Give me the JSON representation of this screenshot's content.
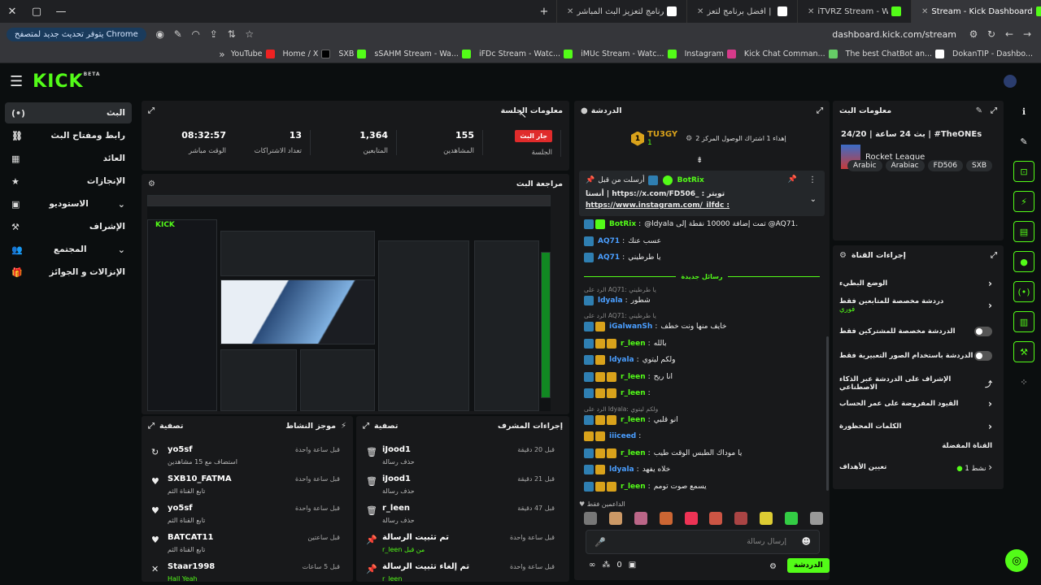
{
  "browser": {
    "tabs": [
      {
        "label": "Stream - Kick Dashboard",
        "active": true
      },
      {
        "label": "iTVRZ Stream - Watch Live on K"
      },
      {
        "label": "بوت الدردشة | أفضل برنامج لتعز"
      },
      {
        "label": "برنامج لتعزيز البث المباشر iFDc"
      }
    ],
    "update_label": "يتوفر تحديث جديد لمتصفح Chrome",
    "url": "dashboard.kick.com/stream",
    "bookmarks": [
      "YouTube",
      "Home / X",
      "SXB",
      "sSAHM Stream - Wa...",
      "iFDc Stream - Watc...",
      "iMUc Stream - Watc...",
      "Instagram",
      "Kick Chat Comman...",
      "The best ChatBot an...",
      "DokanTIP - Dashbo..."
    ]
  },
  "kick": {
    "logo": "KICK",
    "beta": "BETA"
  },
  "sidebar": {
    "items": [
      {
        "label": "البث",
        "icon": "(•)"
      },
      {
        "label": "رابط ومفتاح البث",
        "icon": "⛓"
      },
      {
        "label": "العائد",
        "icon": "▦"
      },
      {
        "label": "الإنجازات",
        "icon": "★"
      },
      {
        "label": "الاستوديو",
        "icon": "▣"
      },
      {
        "label": "الإشراف",
        "icon": "⚒"
      },
      {
        "label": "المجتمع",
        "icon": "👥"
      },
      {
        "label": "الإنزالات و الجوائز",
        "icon": "🎁"
      }
    ]
  },
  "session": {
    "title": "معلومات الجلسة",
    "live_badge": "جار البث",
    "live_label": "الجلسة",
    "stats": [
      {
        "value": "155",
        "label": "المشاهدين"
      },
      {
        "value": "1,364",
        "label": "المتابعين"
      },
      {
        "value": "13",
        "label": "تعداد الاشتراكات"
      },
      {
        "value": "08:32:57",
        "label": "الوقت مباشر"
      }
    ]
  },
  "preview": {
    "title": "مراجعة البث"
  },
  "activity": {
    "title": "موجز النشاط",
    "filter": "تصفية",
    "rows": [
      {
        "name": "yo5sf",
        "sub": "استضاف مع 15 مشاهدين",
        "time": "قبل ساعة واحدة",
        "icon": "↻"
      },
      {
        "name": "SXB10_FATMA",
        "sub": "تابع القناة الثم",
        "time": "قبل ساعة واحدة",
        "icon": "♥"
      },
      {
        "name": "yo5sf",
        "sub": "تابع القناة الثم",
        "time": "قبل ساعة واحدة",
        "icon": "♥"
      },
      {
        "name": "BATCAT11",
        "sub": "تابع القناة الثم",
        "time": "قبل ساعتين",
        "icon": "♥"
      },
      {
        "name": "Staar1998",
        "sub": "Hall Yeah",
        "time": "قبل 5 ساعات",
        "icon": "✕"
      }
    ]
  },
  "modactions": {
    "title": "إجراءات المشرف",
    "filter": "تصفية",
    "rows": [
      {
        "name": "iJood1",
        "sub": "حذف رسالة",
        "time": "قبل 20 دقيقة",
        "icon": "🗑"
      },
      {
        "name": "iJood1",
        "sub": "حذف رسالة",
        "time": "قبل 21 دقيقة",
        "icon": "🗑"
      },
      {
        "name": "r_leen",
        "sub": "حذف رسالة",
        "time": "قبل 47 دقيقة",
        "icon": "🗑"
      },
      {
        "name": "تم تثبيت الرسالة",
        "sub": "r_leen من قبل",
        "time": "قبل ساعة واحدة",
        "icon": "📌"
      },
      {
        "name": "تم إلغاء تثبيت الرسالة",
        "sub": "r_leen",
        "time": "قبل ساعة واحدة",
        "icon": "📌"
      }
    ]
  },
  "chat": {
    "title": "الدردشة",
    "top_user": "TU3GY",
    "top_rank": "1",
    "top_count": "1",
    "goal_text": "إهداء 1 اشتراك الوصول المركز 2",
    "pinned_by": "أرسلت من قبل",
    "pinned_user": "BotRix",
    "pinned_line1": "أنستا | https://x.com/FD506_ : تويتر",
    "pinned_line2": "https://www.instagram.com/_ilfdc :",
    "new_messages": "رسائل جديدة",
    "messages": [
      {
        "user": "BotRix",
        "text": "@ldyala تمت إضافة 10000 نقطة إلى @AQ71.",
        "color": "#53fc18",
        "badges": [
          "bv",
          "bg"
        ]
      },
      {
        "user": "AQ71",
        "text": "عسب عنك",
        "color": "#4a9eff",
        "badges": [
          "bv"
        ]
      },
      {
        "user": "AQ71",
        "text": "يا طرطيني",
        "color": "#4a9eff",
        "badges": [
          "bv"
        ]
      },
      {
        "reply": "الرد على AQ71: يا طرطيني"
      },
      {
        "user": "ldyala",
        "text": "شطور",
        "color": "#4a9eff",
        "badges": [
          "bv"
        ]
      },
      {
        "reply": "الرد على AQ71: يا طرطيني"
      },
      {
        "user": "iGalwanSh",
        "text": "خايف منها ونت خطف",
        "color": "#4a9eff",
        "badges": [
          "bv",
          "bc"
        ]
      },
      {
        "user": "r_leen",
        "text": "بالله",
        "color": "#53fc18",
        "badges": [
          "bv",
          "bc",
          "bc"
        ]
      },
      {
        "user": "ldyala",
        "text": "ولكم ليتوي",
        "color": "#4a9eff",
        "badges": [
          "bv",
          "bc"
        ]
      },
      {
        "user": "r_leen",
        "text": "انا ربح",
        "color": "#53fc18",
        "badges": [
          "bv",
          "bc",
          "bc"
        ]
      },
      {
        "user": "r_leen",
        "text": "",
        "color": "#53fc18",
        "badges": [
          "bv",
          "bc",
          "bc"
        ]
      },
      {
        "reply": "الرد على ldyala: ولكم ليتوي"
      },
      {
        "user": "r_leen",
        "text": "انو قلبي",
        "color": "#53fc18",
        "badges": [
          "bv",
          "bc",
          "bc"
        ]
      },
      {
        "user": "iiiceed",
        "text": "",
        "color": "#4a9eff",
        "badges": [
          "bc",
          "bc"
        ]
      },
      {
        "user": "r_leen",
        "text": "يا موداك الطبس الوقت طيب",
        "color": "#53fc18",
        "badges": [
          "bv",
          "bc",
          "bc"
        ]
      },
      {
        "user": "ldyala",
        "text": "خلاه يفهد",
        "color": "#4a9eff",
        "badges": [
          "bv",
          "bc"
        ]
      },
      {
        "user": "r_leen",
        "text": "يسمع صوت تومم",
        "color": "#53fc18",
        "badges": [
          "bv",
          "bc",
          "bc"
        ]
      }
    ],
    "supporters_label": "الداعمين فقط",
    "input_placeholder": "إرسال رسالة",
    "send_label": "الدردشة",
    "bottom_count": "0"
  },
  "streaminfo": {
    "title": "معلومات البث",
    "stream_title": "بث 24 ساعة | 24/20 | #TheONEs",
    "category": "Rocket League",
    "tags": [
      "SXB",
      "FD506",
      "Arabiac",
      "Arabic"
    ]
  },
  "channelactions": {
    "title": "إجراءات القناة",
    "items": [
      {
        "label": "الوضع البطيء",
        "control": "chevron"
      },
      {
        "label": "دردشة مخصصة للمتابعين فقط",
        "sub": "فوري",
        "control": "chevron"
      },
      {
        "label": "الدردشة مخصصة للمشتركين فقط",
        "control": "toggle"
      },
      {
        "label": "الدردشة باستخدام الصور التعبيرية فقط",
        "control": "toggle"
      },
      {
        "label": "الإشراف على الدردشة عبر الذكاء الاصطناعي",
        "control": "external"
      },
      {
        "label": "القيود المفروضة على عمر الحساب",
        "control": "chevron"
      },
      {
        "label": "الكلمات المحظورة",
        "control": "chevron"
      }
    ],
    "fav_title": "القناة المفضلة",
    "goal_label": "تعيين الأهداف",
    "goal_value": "نشط 1"
  }
}
